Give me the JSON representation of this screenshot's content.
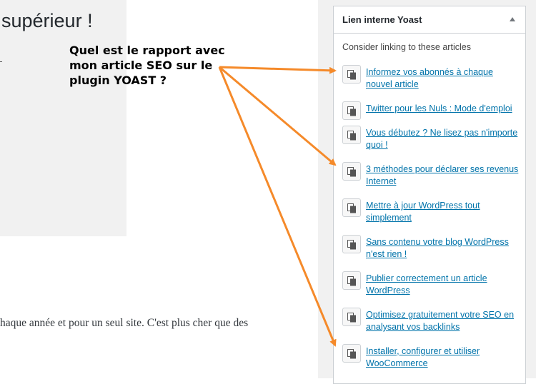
{
  "editor": {
    "heading_fragment": "supérieur !",
    "body_fragment": "haque année et pour un seul site. C'est plus cher que des"
  },
  "annotation": {
    "lines": [
      "Quel est le rapport avec",
      "mon article SEO sur le",
      "plugin YOAST ?"
    ],
    "color": "#f58a2a"
  },
  "sidebar": {
    "metabox_title": "Lien interne Yoast",
    "intro": "Consider linking to these articles",
    "link_color": "#0073aa",
    "items": [
      {
        "label": "Informez vos abonnés à chaque nouvel article",
        "icon": "copy-link-icon"
      },
      {
        "label": "Twitter pour les Nuls : Mode d'emploi",
        "icon": "copy-link-icon"
      },
      {
        "label": "Vous débutez ? Ne lisez pas n'importe quoi !",
        "icon": "copy-link-icon"
      },
      {
        "label": "3 méthodes pour déclarer ses revenus Internet",
        "icon": "copy-link-icon"
      },
      {
        "label": "Mettre à jour WordPress tout simplement",
        "icon": "copy-link-icon"
      },
      {
        "label": "Sans contenu votre blog WordPress n'est rien !",
        "icon": "copy-link-icon"
      },
      {
        "label": "Publier correctement un article WordPress",
        "icon": "copy-link-icon"
      },
      {
        "label": "Optimisez gratuitement votre SEO en analysant vos backlinks",
        "icon": "copy-link-icon"
      },
      {
        "label": "Installer, configurer et utiliser WooCommerce",
        "icon": "copy-link-icon"
      }
    ]
  }
}
